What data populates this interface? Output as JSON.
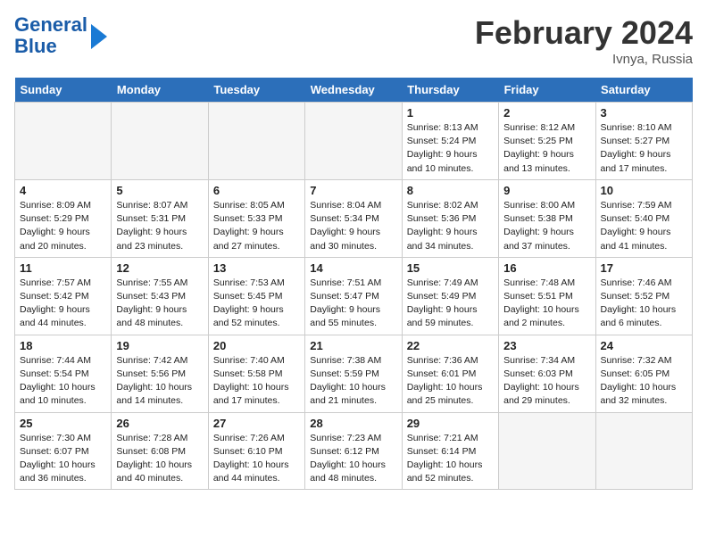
{
  "logo": {
    "line1": "General",
    "line2": "Blue"
  },
  "title": "February 2024",
  "location": "Ivnya, Russia",
  "days_of_week": [
    "Sunday",
    "Monday",
    "Tuesday",
    "Wednesday",
    "Thursday",
    "Friday",
    "Saturday"
  ],
  "weeks": [
    [
      {
        "day": "",
        "info": ""
      },
      {
        "day": "",
        "info": ""
      },
      {
        "day": "",
        "info": ""
      },
      {
        "day": "",
        "info": ""
      },
      {
        "day": "1",
        "info": "Sunrise: 8:13 AM\nSunset: 5:24 PM\nDaylight: 9 hours\nand 10 minutes."
      },
      {
        "day": "2",
        "info": "Sunrise: 8:12 AM\nSunset: 5:25 PM\nDaylight: 9 hours\nand 13 minutes."
      },
      {
        "day": "3",
        "info": "Sunrise: 8:10 AM\nSunset: 5:27 PM\nDaylight: 9 hours\nand 17 minutes."
      }
    ],
    [
      {
        "day": "4",
        "info": "Sunrise: 8:09 AM\nSunset: 5:29 PM\nDaylight: 9 hours\nand 20 minutes."
      },
      {
        "day": "5",
        "info": "Sunrise: 8:07 AM\nSunset: 5:31 PM\nDaylight: 9 hours\nand 23 minutes."
      },
      {
        "day": "6",
        "info": "Sunrise: 8:05 AM\nSunset: 5:33 PM\nDaylight: 9 hours\nand 27 minutes."
      },
      {
        "day": "7",
        "info": "Sunrise: 8:04 AM\nSunset: 5:34 PM\nDaylight: 9 hours\nand 30 minutes."
      },
      {
        "day": "8",
        "info": "Sunrise: 8:02 AM\nSunset: 5:36 PM\nDaylight: 9 hours\nand 34 minutes."
      },
      {
        "day": "9",
        "info": "Sunrise: 8:00 AM\nSunset: 5:38 PM\nDaylight: 9 hours\nand 37 minutes."
      },
      {
        "day": "10",
        "info": "Sunrise: 7:59 AM\nSunset: 5:40 PM\nDaylight: 9 hours\nand 41 minutes."
      }
    ],
    [
      {
        "day": "11",
        "info": "Sunrise: 7:57 AM\nSunset: 5:42 PM\nDaylight: 9 hours\nand 44 minutes."
      },
      {
        "day": "12",
        "info": "Sunrise: 7:55 AM\nSunset: 5:43 PM\nDaylight: 9 hours\nand 48 minutes."
      },
      {
        "day": "13",
        "info": "Sunrise: 7:53 AM\nSunset: 5:45 PM\nDaylight: 9 hours\nand 52 minutes."
      },
      {
        "day": "14",
        "info": "Sunrise: 7:51 AM\nSunset: 5:47 PM\nDaylight: 9 hours\nand 55 minutes."
      },
      {
        "day": "15",
        "info": "Sunrise: 7:49 AM\nSunset: 5:49 PM\nDaylight: 9 hours\nand 59 minutes."
      },
      {
        "day": "16",
        "info": "Sunrise: 7:48 AM\nSunset: 5:51 PM\nDaylight: 10 hours\nand 2 minutes."
      },
      {
        "day": "17",
        "info": "Sunrise: 7:46 AM\nSunset: 5:52 PM\nDaylight: 10 hours\nand 6 minutes."
      }
    ],
    [
      {
        "day": "18",
        "info": "Sunrise: 7:44 AM\nSunset: 5:54 PM\nDaylight: 10 hours\nand 10 minutes."
      },
      {
        "day": "19",
        "info": "Sunrise: 7:42 AM\nSunset: 5:56 PM\nDaylight: 10 hours\nand 14 minutes."
      },
      {
        "day": "20",
        "info": "Sunrise: 7:40 AM\nSunset: 5:58 PM\nDaylight: 10 hours\nand 17 minutes."
      },
      {
        "day": "21",
        "info": "Sunrise: 7:38 AM\nSunset: 5:59 PM\nDaylight: 10 hours\nand 21 minutes."
      },
      {
        "day": "22",
        "info": "Sunrise: 7:36 AM\nSunset: 6:01 PM\nDaylight: 10 hours\nand 25 minutes."
      },
      {
        "day": "23",
        "info": "Sunrise: 7:34 AM\nSunset: 6:03 PM\nDaylight: 10 hours\nand 29 minutes."
      },
      {
        "day": "24",
        "info": "Sunrise: 7:32 AM\nSunset: 6:05 PM\nDaylight: 10 hours\nand 32 minutes."
      }
    ],
    [
      {
        "day": "25",
        "info": "Sunrise: 7:30 AM\nSunset: 6:07 PM\nDaylight: 10 hours\nand 36 minutes."
      },
      {
        "day": "26",
        "info": "Sunrise: 7:28 AM\nSunset: 6:08 PM\nDaylight: 10 hours\nand 40 minutes."
      },
      {
        "day": "27",
        "info": "Sunrise: 7:26 AM\nSunset: 6:10 PM\nDaylight: 10 hours\nand 44 minutes."
      },
      {
        "day": "28",
        "info": "Sunrise: 7:23 AM\nSunset: 6:12 PM\nDaylight: 10 hours\nand 48 minutes."
      },
      {
        "day": "29",
        "info": "Sunrise: 7:21 AM\nSunset: 6:14 PM\nDaylight: 10 hours\nand 52 minutes."
      },
      {
        "day": "",
        "info": ""
      },
      {
        "day": "",
        "info": ""
      }
    ]
  ]
}
